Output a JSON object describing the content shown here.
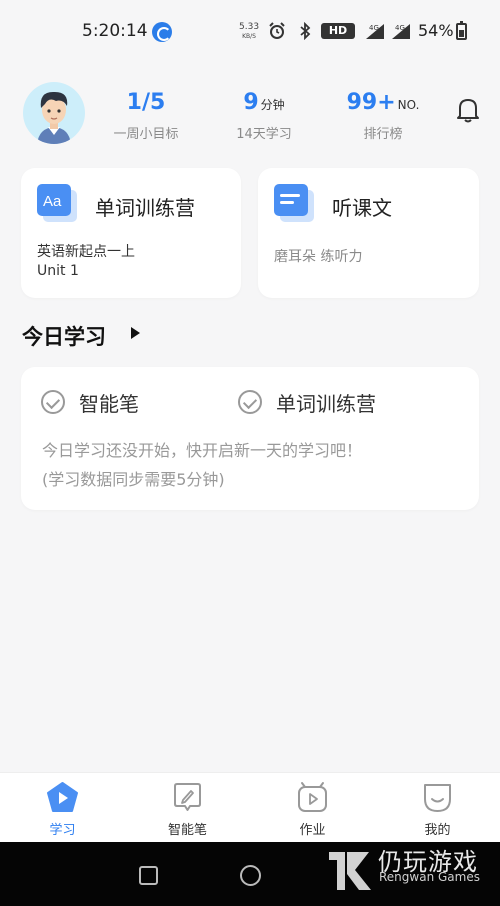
{
  "status_bar": {
    "time": "5:20:14",
    "speed_value": "5.33",
    "speed_unit": "KB/S",
    "hd": "HD",
    "network": "4G",
    "battery": "54%"
  },
  "header": {
    "goal_value": "1/5",
    "goal_label": "一周小目标",
    "minutes_value": "9",
    "minutes_unit": "分钟",
    "minutes_label": "14天学习",
    "rank_value": "99+",
    "rank_unit": "NO.",
    "rank_label": "排行榜"
  },
  "cards": {
    "words": {
      "icon_text": "Aa",
      "title": "单词训练营",
      "line1": "英语新起点一上",
      "line2": "Unit 1"
    },
    "listen": {
      "title": "听课文",
      "line1": "磨耳朵 练听力"
    }
  },
  "today": {
    "title": "今日学习",
    "items": [
      {
        "label": "智能笔"
      },
      {
        "label": "单词训练营"
      }
    ],
    "message_line1": "今日学习还没开始，快开启新一天的学习吧！",
    "message_line2": "(学习数据同步需要5分钟)"
  },
  "bottom_nav": {
    "items": [
      {
        "label": "学习",
        "active": true
      },
      {
        "label": "智能笔",
        "active": false
      },
      {
        "label": "作业",
        "active": false
      },
      {
        "label": "我的",
        "active": false
      }
    ]
  },
  "watermark": {
    "cn": "仍玩游戏",
    "en": "Rengwan Games"
  },
  "colors": {
    "accent": "#2c7ef0",
    "background": "#f6f6f7",
    "card": "#ffffff",
    "muted_text": "#8a8a8a"
  }
}
